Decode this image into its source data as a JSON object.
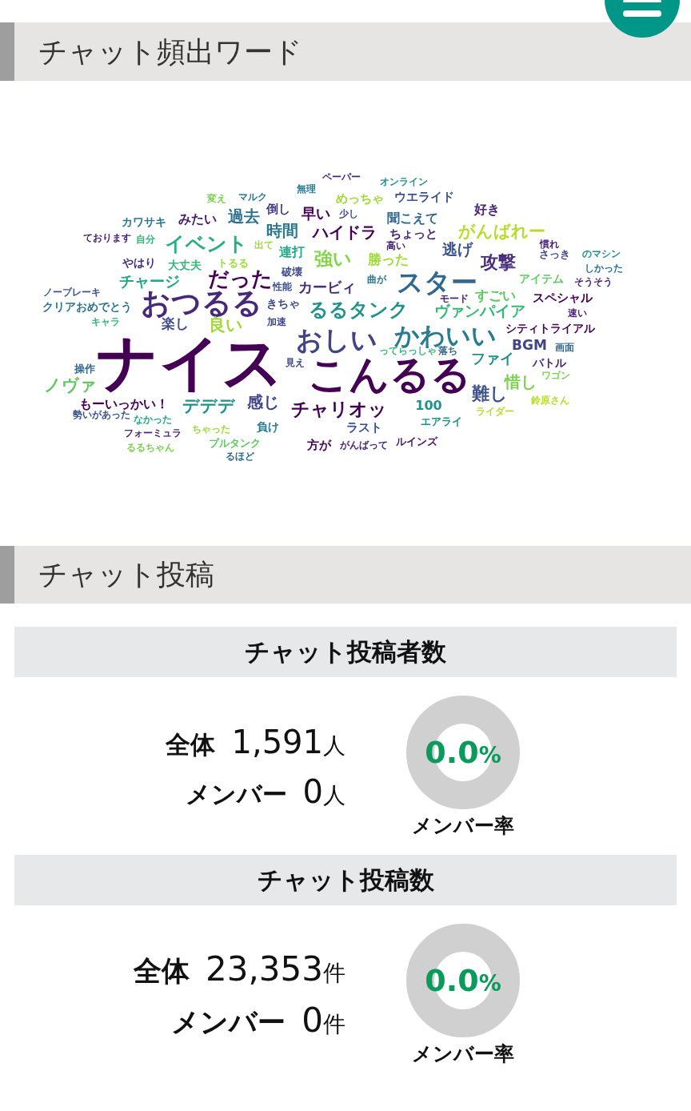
{
  "sections": [
    {
      "kind": "word_cloud",
      "title": "チャット頻出ワード",
      "words": [
        {
          "text": "無理",
          "color": "#2a788e"
        },
        {
          "text": "ペーパー",
          "color": "#482475"
        },
        {
          "text": "オンライン",
          "color": "#21918c"
        },
        {
          "text": "変え",
          "color": "#7ad151"
        },
        {
          "text": "マルク",
          "color": "#2a788e"
        },
        {
          "text": "めっちゃ",
          "color": "#a0da39"
        },
        {
          "text": "ウエライド",
          "color": "#3b528b"
        },
        {
          "text": "カワサキ",
          "color": "#2a788e"
        },
        {
          "text": "みたい",
          "color": "#481a6c"
        },
        {
          "text": "過去",
          "color": "#2c728e"
        },
        {
          "text": "倒し",
          "color": "#443983"
        },
        {
          "text": "早い",
          "color": "#440154"
        },
        {
          "text": "少し",
          "color": "#414487"
        },
        {
          "text": "聞こえて",
          "color": "#31688e"
        },
        {
          "text": "好き",
          "color": "#482475"
        },
        {
          "text": "ております",
          "color": "#482475"
        },
        {
          "text": "自分",
          "color": "#35b779"
        },
        {
          "text": "イベント",
          "color": "#29af7f"
        },
        {
          "text": "時間",
          "color": "#2a788e"
        },
        {
          "text": "出て",
          "color": "#a0da39"
        },
        {
          "text": "ハイドラ",
          "color": "#440154"
        },
        {
          "text": "ちょっと",
          "color": "#482475"
        },
        {
          "text": "がんばれー",
          "color": "#b5de2b"
        },
        {
          "text": "やはり",
          "color": "#46307e"
        },
        {
          "text": "大丈夫",
          "color": "#35b779"
        },
        {
          "text": "トるる",
          "color": "#a0da39"
        },
        {
          "text": "連打",
          "color": "#22a884"
        },
        {
          "text": "強い",
          "color": "#84d44b"
        },
        {
          "text": "高い",
          "color": "#482475"
        },
        {
          "text": "勝った",
          "color": "#a0da39"
        },
        {
          "text": "逃げ",
          "color": "#3b528b"
        },
        {
          "text": "攻撃",
          "color": "#472d7b"
        },
        {
          "text": "慣れ",
          "color": "#482475"
        },
        {
          "text": "さっき",
          "color": "#414487"
        },
        {
          "text": "のマシン",
          "color": "#21918c"
        },
        {
          "text": "ノーブレーキ",
          "color": "#3b528b"
        },
        {
          "text": "チャージ",
          "color": "#22a884"
        },
        {
          "text": "だった",
          "color": "#440154"
        },
        {
          "text": "破壊",
          "color": "#3e4a89"
        },
        {
          "text": "性能",
          "color": "#3b528b"
        },
        {
          "text": "カービィ",
          "color": "#472d7b"
        },
        {
          "text": "曲が",
          "color": "#2a788e"
        },
        {
          "text": "スター",
          "color": "#31688e"
        },
        {
          "text": "アイテム",
          "color": "#5ec962"
        },
        {
          "text": "しかった",
          "color": "#2c728e"
        },
        {
          "text": "そうそう",
          "color": "#482475"
        },
        {
          "text": "クリアおめでとう",
          "color": "#2c728e"
        },
        {
          "text": "おつるる",
          "color": "#482878"
        },
        {
          "text": "きちゃ",
          "color": "#3e4a89"
        },
        {
          "text": "るるタンク",
          "color": "#21918c"
        },
        {
          "text": "モード",
          "color": "#482475"
        },
        {
          "text": "すごい",
          "color": "#5ec962"
        },
        {
          "text": "ヴァンパイア",
          "color": "#35b779"
        },
        {
          "text": "スペシャル",
          "color": "#440154"
        },
        {
          "text": "速い",
          "color": "#482475"
        },
        {
          "text": "キャラ",
          "color": "#35b779"
        },
        {
          "text": "楽し",
          "color": "#3e4a89"
        },
        {
          "text": "良い",
          "color": "#a0da39"
        },
        {
          "text": "加速",
          "color": "#3e4a89"
        },
        {
          "text": "操作",
          "color": "#31688e"
        },
        {
          "text": "ノヴァ",
          "color": "#5ec962"
        },
        {
          "text": "ナイス",
          "color": "#440154"
        },
        {
          "text": "おしい",
          "color": "#414487"
        },
        {
          "text": "かわいい",
          "color": "#287c8e"
        },
        {
          "text": "ってらっしゃ",
          "color": "#35b779"
        },
        {
          "text": "落ち",
          "color": "#31688e"
        },
        {
          "text": "シティトライアル",
          "color": "#440154"
        },
        {
          "text": "BGM",
          "color": "#414487"
        },
        {
          "text": "画面",
          "color": "#31688e"
        },
        {
          "text": "見え",
          "color": "#3e4a89"
        },
        {
          "text": "こんるる",
          "color": "#440154"
        },
        {
          "text": "ファイ",
          "color": "#21918c"
        },
        {
          "text": "バトル",
          "color": "#482475"
        },
        {
          "text": "惜し",
          "color": "#7ad151"
        },
        {
          "text": "ワゴン",
          "color": "#7ad151"
        },
        {
          "text": "もーいっかい！",
          "color": "#440154"
        },
        {
          "text": "勢いがあった",
          "color": "#3b528b"
        },
        {
          "text": "デデデ",
          "color": "#21918c"
        },
        {
          "text": "感じ",
          "color": "#414487"
        },
        {
          "text": "チャリオッ",
          "color": "#440154"
        },
        {
          "text": "100",
          "color": "#21918c"
        },
        {
          "text": "難し",
          "color": "#3b528b"
        },
        {
          "text": "ライダー",
          "color": "#b5de2b"
        },
        {
          "text": "鈴原さん",
          "color": "#b5de2b"
        },
        {
          "text": "なかった",
          "color": "#22a884"
        },
        {
          "text": "フォーミュラ",
          "color": "#482475"
        },
        {
          "text": "ちゃった",
          "color": "#a0da39"
        },
        {
          "text": "負け",
          "color": "#2a788e"
        },
        {
          "text": "ラスト",
          "color": "#3b528b"
        },
        {
          "text": "エアライ",
          "color": "#21918c"
        },
        {
          "text": "るるちゃん",
          "color": "#7ad151"
        },
        {
          "text": "ブルタンク",
          "color": "#5ec962"
        },
        {
          "text": "方が",
          "color": "#440154"
        },
        {
          "text": "がんばって",
          "color": "#482475"
        },
        {
          "text": "ルインズ",
          "color": "#481a6c"
        },
        {
          "text": "るほど",
          "color": "#31688e"
        }
      ]
    },
    {
      "kind": "stats",
      "title": "チャット投稿",
      "groups": [
        {
          "title": "チャット投稿者数",
          "rows": [
            {
              "label": "全体",
              "value": "1,591",
              "unit": "人"
            },
            {
              "label": "メンバー",
              "value": "0",
              "unit": "人"
            }
          ],
          "rate": {
            "value": "0.0",
            "unit": "%",
            "label": "メンバー率"
          }
        },
        {
          "title": "チャット投稿数",
          "rows": [
            {
              "label": "全体",
              "value": "23,353",
              "unit": "件"
            },
            {
              "label": "メンバー",
              "value": "0",
              "unit": "件"
            }
          ],
          "rate": {
            "value": "0.0",
            "unit": "%",
            "label": "メンバー率"
          }
        }
      ]
    }
  ]
}
